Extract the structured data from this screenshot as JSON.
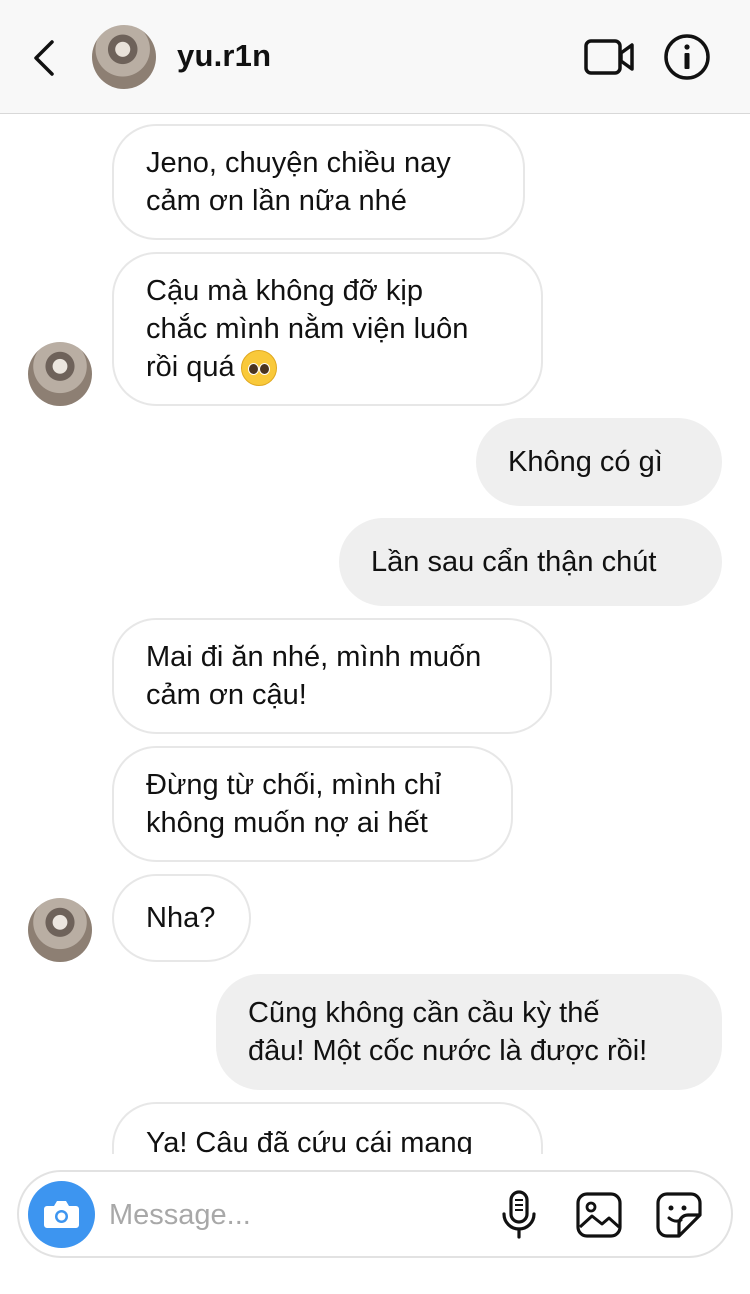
{
  "header": {
    "back_icon": "chevron-left-icon",
    "username": "yu.r1n",
    "video_icon": "video-camera-icon",
    "info_icon": "info-icon"
  },
  "messages": [
    {
      "sender": "them",
      "text": "Jeno, chuyện chiều nay\ncảm ơn lần nữa nhé"
    },
    {
      "sender": "them",
      "text": "Cậu mà không đỡ kịp\nchắc mình nằm viện luôn\nrồi quá",
      "emoji": "pleading-face-emoji"
    },
    {
      "sender": "me",
      "text": "Không có gì"
    },
    {
      "sender": "me",
      "text": "Lần sau cẩn thận chút"
    },
    {
      "sender": "them",
      "text": "Mai đi ăn nhé, mình muốn\ncảm ơn cậu!"
    },
    {
      "sender": "them",
      "text": "Đừng từ chối, mình chỉ\nkhông muốn nợ ai hết"
    },
    {
      "sender": "them",
      "text": "Nha?"
    },
    {
      "sender": "me",
      "text": "Cũng không cần cầu kỳ thế\nđâu! Một cốc nước là được rồi!"
    },
    {
      "sender": "them",
      "text": "Ya! Cậu đã cứu cái mạng"
    }
  ],
  "composer": {
    "placeholder": "Message...",
    "camera_icon": "camera-icon",
    "mic_icon": "microphone-icon",
    "gallery_icon": "gallery-icon",
    "sticker_icon": "sticker-icon"
  },
  "colors": {
    "accent": "#3d95f0",
    "outgoing_bubble": "#efefef",
    "incoming_border": "#e7e7e7"
  }
}
